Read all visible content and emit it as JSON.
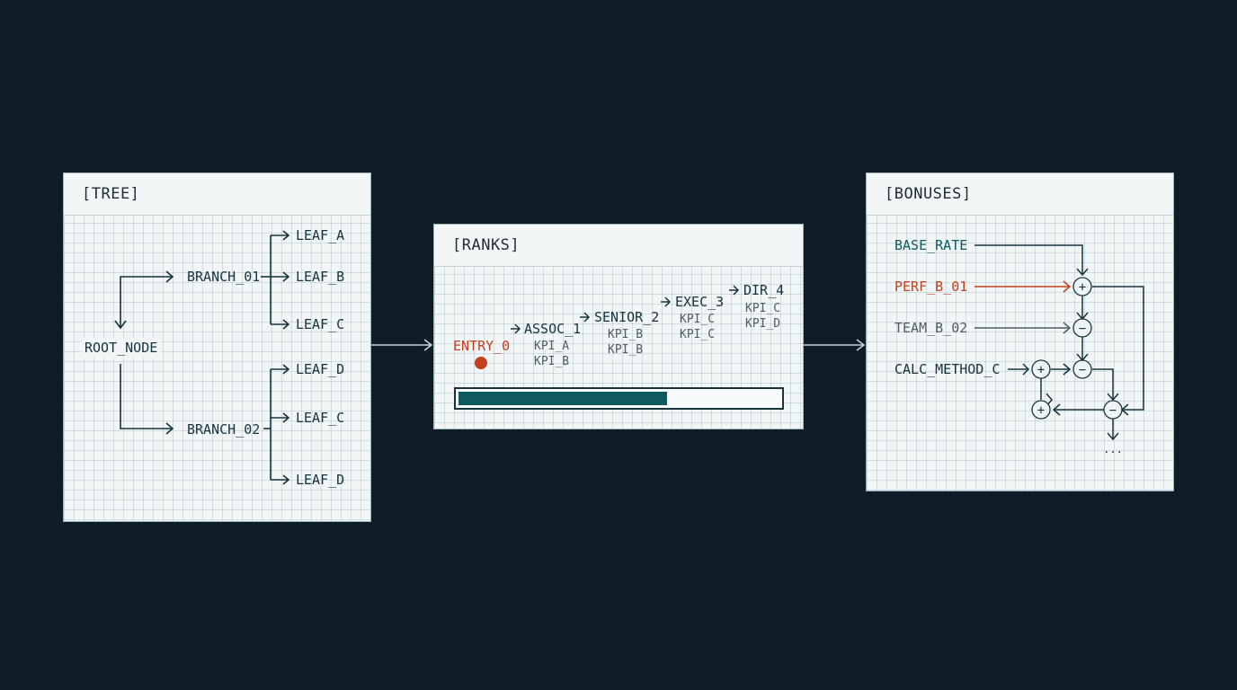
{
  "colors": {
    "background": "#0e1c27",
    "ink": "#16323d",
    "teal": "#0f5a5e",
    "accent": "#c4401f",
    "muted": "#4b5d66"
  },
  "tree": {
    "title": "[TREE]",
    "root": "ROOT_NODE",
    "branches": [
      {
        "label": "BRANCH_01",
        "leaves": [
          "LEAF_A",
          "LEAF_B",
          "LEAF_C"
        ]
      },
      {
        "label": "BRANCH_02",
        "leaves": [
          "LEAF_D",
          "LEAF_C",
          "LEAF_D"
        ]
      }
    ]
  },
  "ranks": {
    "title": "[RANKS]",
    "entry": "ENTRY_0",
    "steps": [
      {
        "label": "ASSOC_1",
        "kpis": [
          "KPI_A",
          "KPI_B"
        ]
      },
      {
        "label": "SENIOR_2",
        "kpis": [
          "KPI_B",
          "KPI_B"
        ]
      },
      {
        "label": "EXEC_3",
        "kpis": [
          "KPI_C",
          "KPI_C"
        ]
      },
      {
        "label": "DIR_4",
        "kpis": [
          "KPI_C",
          "KPI_D"
        ]
      }
    ],
    "progress": 0.65
  },
  "bonuses": {
    "title": "[BONUSES]",
    "inputs": [
      "BASE_RATE",
      "PERF_B_01",
      "TEAM_B_02",
      "CALC_METHOD_C"
    ],
    "ops": {
      "plus": "+",
      "minus": "−"
    },
    "continuation": "..."
  }
}
